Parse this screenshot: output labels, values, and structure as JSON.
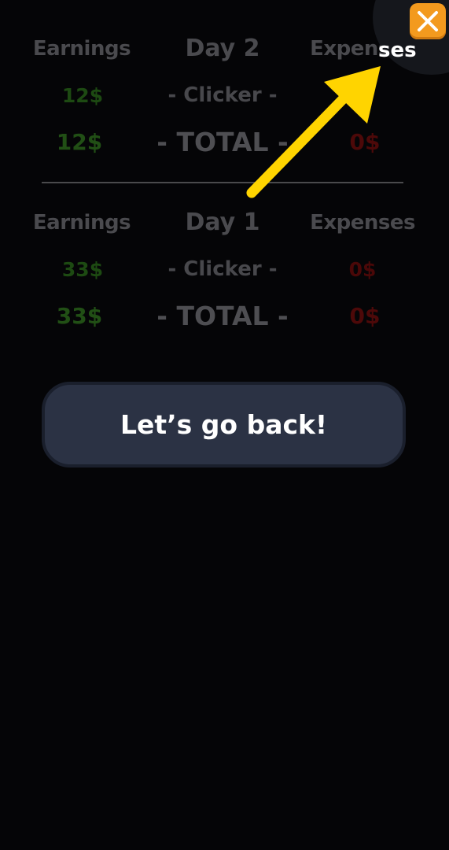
{
  "days": [
    {
      "title": "Day 2",
      "earnings_header": "Earnings",
      "expenses_header": "Expenses",
      "source_label": "- Clicker -",
      "earnings_value": "12$",
      "expenses_value": "",
      "total_label": "- TOTAL -",
      "earnings_total": "12$",
      "expenses_total": "0$"
    },
    {
      "title": "Day 1",
      "earnings_header": "Earnings",
      "expenses_header": "Expenses",
      "source_label": "- Clicker -",
      "earnings_value": "33$",
      "expenses_value": "0$",
      "total_label": "- TOTAL -",
      "earnings_total": "33$",
      "expenses_total": "0$"
    }
  ],
  "tutorial": {
    "highlight_text": "ses",
    "arrow_color": "#ffd400",
    "close_button_color": "#f39a1e",
    "close_icon": "close-icon"
  },
  "back_button": {
    "label": "Let’s go back!"
  }
}
